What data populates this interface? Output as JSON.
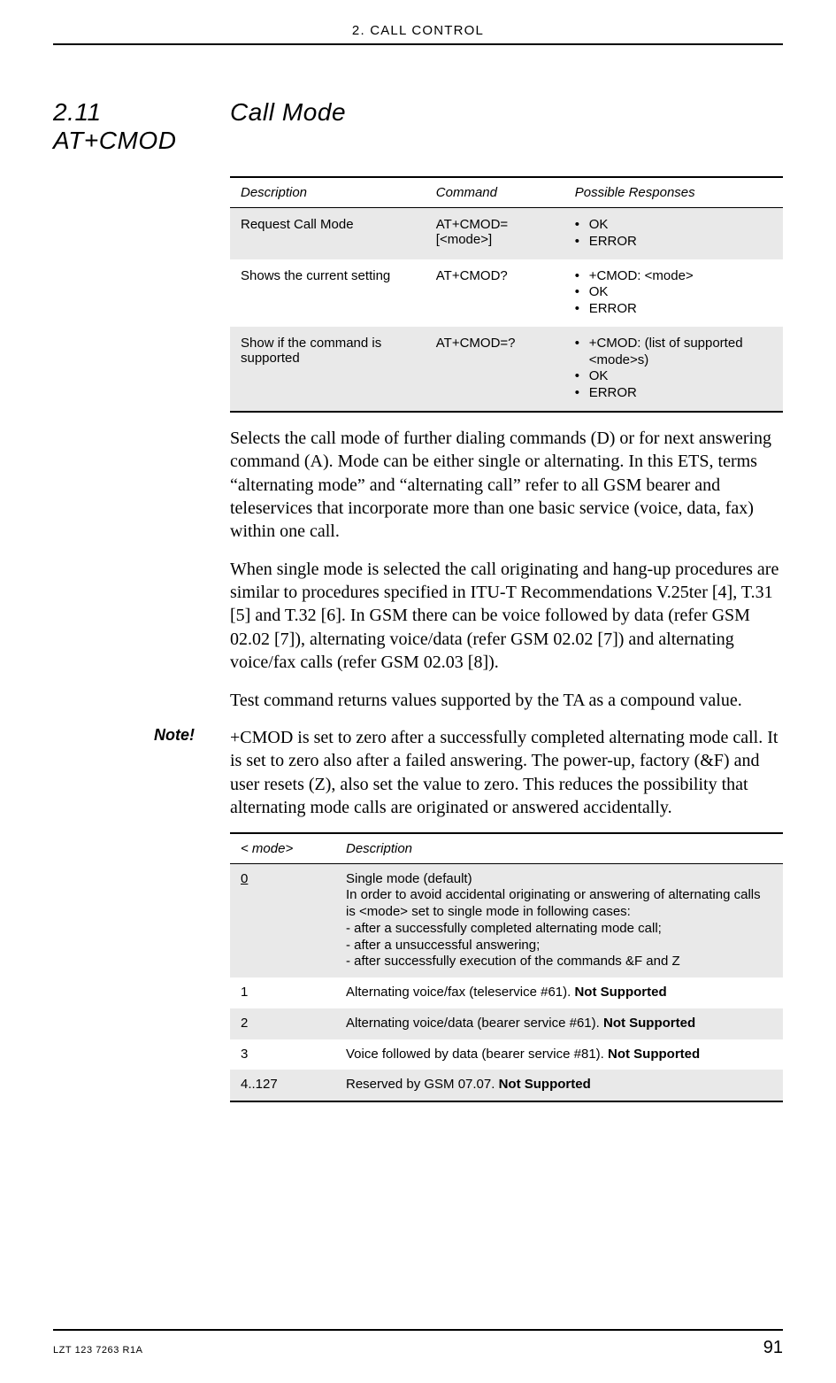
{
  "header": {
    "chapter": "2. CALL CONTROL"
  },
  "section": {
    "number": "2.11 AT+CMOD",
    "title": "Call Mode"
  },
  "cmd_table": {
    "headers": [
      "Description",
      "Command",
      "Possible Responses"
    ],
    "rows": [
      {
        "desc": "Request Call Mode",
        "cmd": "AT+CMOD=[<mode>]",
        "resp": [
          "OK",
          "ERROR"
        ],
        "shade": true
      },
      {
        "desc": "Shows the current setting",
        "cmd": "AT+CMOD?",
        "resp": [
          "+CMOD: <mode>",
          "OK",
          "ERROR"
        ],
        "shade": false
      },
      {
        "desc": "Show if the command is supported",
        "cmd": "AT+CMOD=?",
        "resp": [
          "+CMOD: (list of supported <mode>s)",
          "OK",
          "ERROR"
        ],
        "shade": true
      }
    ]
  },
  "paras": {
    "p1": "Selects the call mode of further dialing commands (D) or for next answering command (A). Mode can be either single or alternating. In this ETS, terms “alternating mode” and “alternating call” refer to all GSM bearer and teleservices that incorporate more than one basic service (voice, data, fax) within one call.",
    "p2": "When single mode is selected the call originating and hang-up procedures are similar to procedures specified in ITU-T Recommendations V.25ter [4], T.31 [5] and T.32 [6]. In GSM there can be voice followed by data (refer GSM 02.02 [7]), alternating voice/data (refer GSM 02.02 [7]) and alternating voice/fax calls (refer GSM 02.03 [8]).",
    "p3": "Test command returns values supported by the TA as a compound value."
  },
  "note": {
    "label": "Note!",
    "text": "+CMOD is set to zero after a successfully completed alternating mode call. It is set to zero also after a failed answering. The power-up, factory (&F) and user resets (Z), also set the value to zero. This reduces the possibility that alternating mode calls are originated or answered accidentally."
  },
  "mode_table": {
    "headers": [
      "< mode>",
      "Description"
    ],
    "rows": [
      {
        "mode": "0",
        "underline": true,
        "shade": true,
        "desc_main": "Single mode (default)\nIn order to avoid accidental originating or answering of alternating calls is <mode> set to single mode in following cases:\n- after a successfully completed alternating mode call;\n- after a unsuccessful answering;\n- after successfully execution of the commands &F and Z",
        "not_supported": ""
      },
      {
        "mode": "1",
        "underline": false,
        "shade": false,
        "desc_main": "Alternating voice/fax (teleservice #61). ",
        "not_supported": "Not Supported"
      },
      {
        "mode": "2",
        "underline": false,
        "shade": true,
        "desc_main": "Alternating voice/data (bearer service #61). ",
        "not_supported": "Not Supported"
      },
      {
        "mode": "3",
        "underline": false,
        "shade": false,
        "desc_main": "Voice followed by data (bearer service #81). ",
        "not_supported": "Not Supported"
      },
      {
        "mode": "4..127",
        "underline": false,
        "shade": true,
        "desc_main": "Reserved by GSM 07.07. ",
        "not_supported": "Not Supported"
      }
    ]
  },
  "footer": {
    "doc_id": "LZT 123 7263 R1A",
    "page": "91"
  }
}
